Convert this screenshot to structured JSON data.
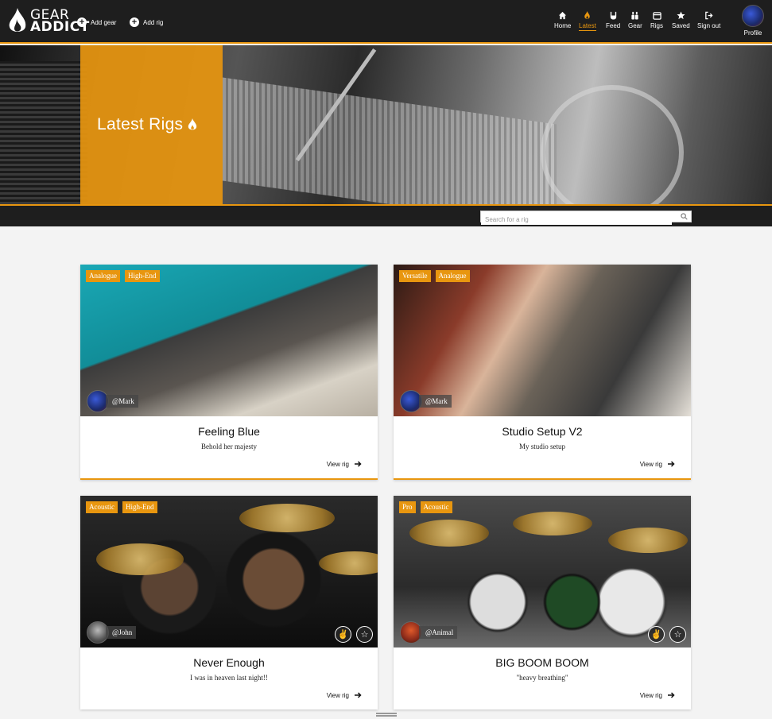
{
  "brand": {
    "line1": "GEAR",
    "line2": "ADDICT"
  },
  "header": {
    "add_gear": "Add gear",
    "add_rig": "Add rig",
    "nav": [
      {
        "label": "Home",
        "icon": "home-icon"
      },
      {
        "label": "Latest",
        "icon": "flame-icon",
        "active": true
      },
      {
        "label": "Feed",
        "icon": "rock-hand-icon"
      },
      {
        "label": "Gear",
        "icon": "gear-stack-icon"
      },
      {
        "label": "Rigs",
        "icon": "rig-icon"
      },
      {
        "label": "Saved",
        "icon": "star-icon"
      },
      {
        "label": "Sign out",
        "icon": "sign-out-icon"
      }
    ],
    "profile": "Profile"
  },
  "hero": {
    "title": "Latest Rigs"
  },
  "search": {
    "placeholder": "Search for a rig"
  },
  "accent_color": "#e8960f",
  "rigs": [
    {
      "title": "Feeling Blue",
      "description": "Behold her majesty",
      "tags": [
        "Analogue",
        "High-End"
      ],
      "owner": "@Mark",
      "view": "View rig"
    },
    {
      "title": "Studio Setup V2",
      "description": "My studio setup",
      "tags": [
        "Versatile",
        "Analogue"
      ],
      "owner": "@Mark",
      "view": "View rig"
    },
    {
      "title": "Never Enough",
      "description": "I was in heaven last night!!",
      "tags": [
        "Acoustic",
        "High-End"
      ],
      "owner": "@John",
      "view": "View rig"
    },
    {
      "title": "BIG BOOM BOOM",
      "description": "\"heavy breathing\"",
      "tags": [
        "Pro",
        "Acoustic"
      ],
      "owner": "@Animal",
      "view": "View rig"
    }
  ]
}
